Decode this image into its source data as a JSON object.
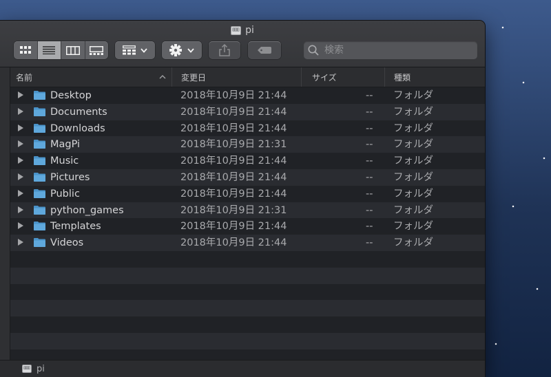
{
  "window": {
    "title": "pi",
    "title_icon": "external-disk-icon"
  },
  "toolbar": {
    "view_buttons": [
      {
        "name": "icon-view-button",
        "icon": "grid-icon",
        "active": false
      },
      {
        "name": "list-view-button",
        "icon": "list-icon",
        "active": true
      },
      {
        "name": "column-view-button",
        "icon": "columns-icon",
        "active": false
      },
      {
        "name": "gallery-view-button",
        "icon": "gallery-icon",
        "active": false
      }
    ],
    "group_button_icon": "group-icon",
    "action_button_icon": "gear-icon",
    "share_button_icon": "share-icon",
    "tag_button_icon": "tag-icon",
    "search_placeholder": "検索"
  },
  "columns": {
    "name": "名前",
    "date": "変更日",
    "size": "サイズ",
    "kind": "種類"
  },
  "files": [
    {
      "name": "Desktop",
      "date": "2018年10月9日 21:44",
      "size": "--",
      "kind": "フォルダ"
    },
    {
      "name": "Documents",
      "date": "2018年10月9日 21:44",
      "size": "--",
      "kind": "フォルダ"
    },
    {
      "name": "Downloads",
      "date": "2018年10月9日 21:44",
      "size": "--",
      "kind": "フォルダ"
    },
    {
      "name": "MagPi",
      "date": "2018年10月9日 21:31",
      "size": "--",
      "kind": "フォルダ"
    },
    {
      "name": "Music",
      "date": "2018年10月9日 21:44",
      "size": "--",
      "kind": "フォルダ"
    },
    {
      "name": "Pictures",
      "date": "2018年10月9日 21:44",
      "size": "--",
      "kind": "フォルダ"
    },
    {
      "name": "Public",
      "date": "2018年10月9日 21:44",
      "size": "--",
      "kind": "フォルダ"
    },
    {
      "name": "python_games",
      "date": "2018年10月9日 21:31",
      "size": "--",
      "kind": "フォルダ"
    },
    {
      "name": "Templates",
      "date": "2018年10月9日 21:44",
      "size": "--",
      "kind": "フォルダ"
    },
    {
      "name": "Videos",
      "date": "2018年10月9日 21:44",
      "size": "--",
      "kind": "フォルダ"
    }
  ],
  "statusbar": {
    "path_label": "pi",
    "path_icon": "external-disk-icon"
  },
  "colors": {
    "folder": "#5fa8dc",
    "row_even": "#202226",
    "row_odd": "#2a2c31"
  }
}
